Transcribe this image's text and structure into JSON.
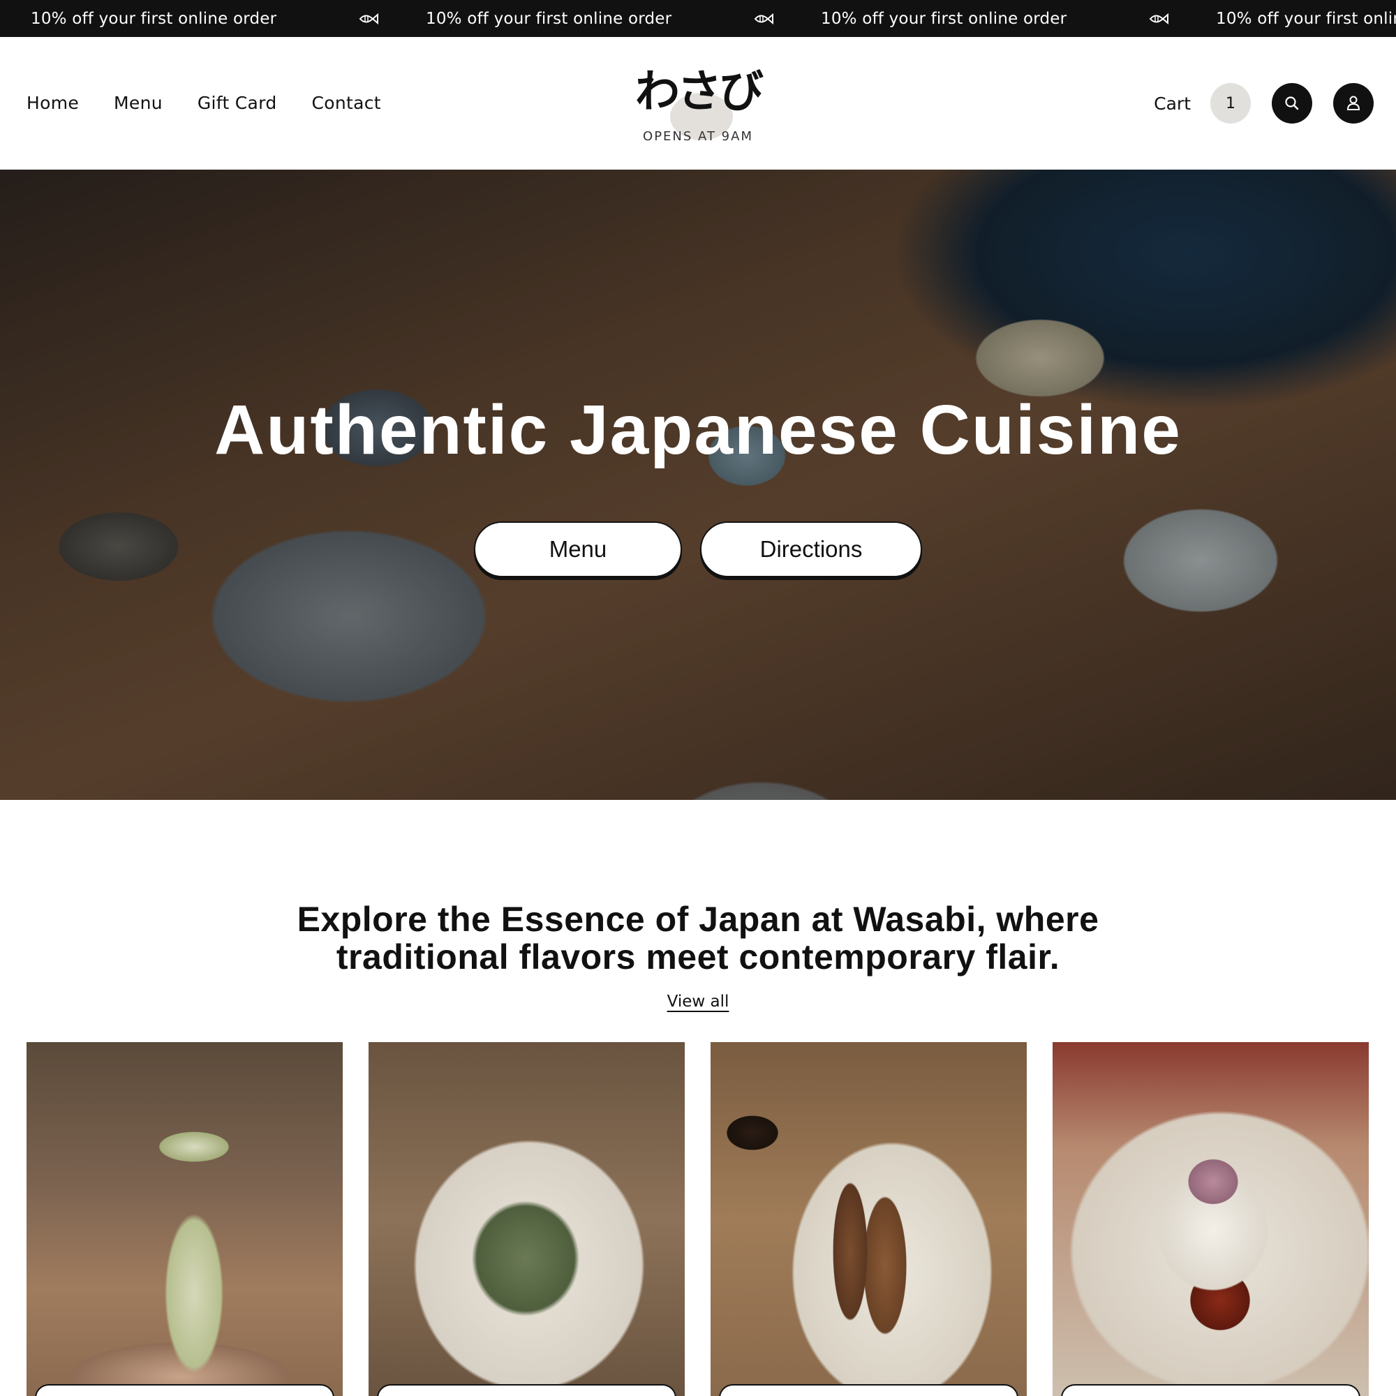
{
  "announcement": {
    "items": [
      "10% off your first online order",
      "10% off your first online order",
      "10% off your first online order",
      "10% off your first online order"
    ],
    "separator_icon": "fish-icon"
  },
  "nav": {
    "items": [
      "Home",
      "Menu",
      "Gift Card",
      "Contact"
    ]
  },
  "logo": {
    "text": "わさび",
    "subtitle": "OPENS AT 9AM"
  },
  "header_actions": {
    "cart_label": "Cart",
    "cart_count": "1",
    "search_icon": "search-icon",
    "account_icon": "user-icon"
  },
  "hero": {
    "title": "Authentic Japanese Cuisine",
    "buttons": [
      "Menu",
      "Directions"
    ]
  },
  "intro": {
    "heading": "Explore the Essence of Japan at Wasabi, where traditional flavors meet contemporary flair.",
    "view_all": "View all"
  },
  "colors": {
    "announcement_bg": "#111111",
    "text": "#111111",
    "cart_badge_bg": "#e2e0dd"
  }
}
